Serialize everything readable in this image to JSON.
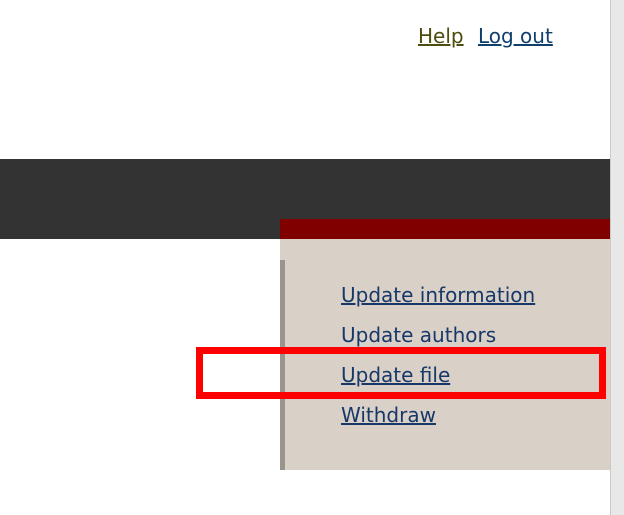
{
  "header": {
    "help_label": "Help",
    "logout_label": "Log out"
  },
  "menu": {
    "items": [
      {
        "label": "Update information"
      },
      {
        "label": "Update authors"
      },
      {
        "label": "Update file"
      },
      {
        "label": "Withdraw"
      }
    ]
  },
  "colors": {
    "header_band": "#333333",
    "menu_accent": "#800000",
    "menu_background": "#d9d0c8",
    "link": "#173868",
    "highlight": "#ff0000"
  }
}
